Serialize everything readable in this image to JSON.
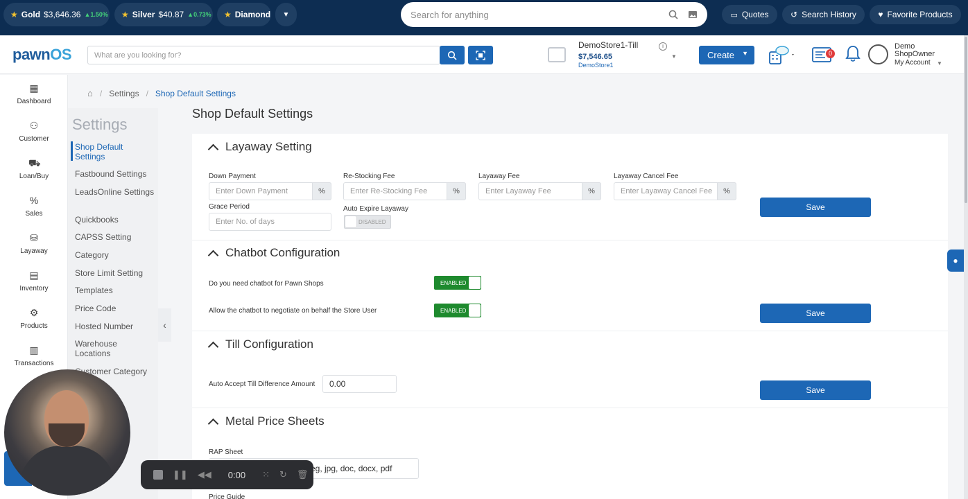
{
  "ticker": {
    "items": [
      {
        "name": "Gold",
        "price": "$3,646.36",
        "change": "▲1.50%"
      },
      {
        "name": "Silver",
        "price": "$40.87",
        "change": "▲0.73%"
      },
      {
        "name": "Diamond",
        "price": "",
        "change": ""
      }
    ],
    "search_placeholder": "Search for anything",
    "quotes_label": "Quotes",
    "history_label": "Search History",
    "favorites_label": "Favorite Products"
  },
  "header": {
    "logo_main": "pawn",
    "logo_accent": "OS",
    "search_placeholder": "What are you looking for?",
    "till_name": "DemoStore1-Till",
    "till_amount": "$7,546.65",
    "till_store": "DemoStore1",
    "create_label": "Create",
    "notification_count": "0",
    "user_name": "Demo ShopOwner",
    "user_account": "My Account"
  },
  "nav": [
    {
      "label": "Dashboard",
      "icon": "dashboard-icon",
      "glyph": "▦"
    },
    {
      "label": "Customer",
      "icon": "customer-icon",
      "glyph": "⚇"
    },
    {
      "label": "Loan/Buy",
      "icon": "loan-icon",
      "glyph": "⛟"
    },
    {
      "label": "Sales",
      "icon": "sales-icon",
      "glyph": "%"
    },
    {
      "label": "Layaway",
      "icon": "layaway-icon",
      "glyph": "⛁"
    },
    {
      "label": "Inventory",
      "icon": "inventory-icon",
      "glyph": "▤"
    },
    {
      "label": "Products",
      "icon": "products-icon",
      "glyph": "⚙"
    },
    {
      "label": "Transactions",
      "icon": "transactions-icon",
      "glyph": "▥"
    }
  ],
  "settings_sidebar": {
    "title": "Settings",
    "items": [
      "Shop Default Settings",
      "Fastbound Settings",
      "LeadsOnline Settings",
      "Quickbooks",
      "CAPSS Setting",
      "Category",
      "Store Limit Setting",
      "Templates",
      "Price Code",
      "Hosted Number",
      "Warehouse Locations",
      "Customer Category"
    ]
  },
  "breadcrumb": {
    "parent": "Settings",
    "current": "Shop Default Settings"
  },
  "page_title": "Shop Default Settings",
  "layaway": {
    "title": "Layaway Setting",
    "down_payment_label": "Down Payment",
    "down_payment_placeholder": "Enter Down Payment",
    "restocking_label": "Re-Stocking Fee",
    "restocking_placeholder": "Enter Re-Stocking Fee",
    "fee_label": "Layaway Fee",
    "fee_placeholder": "Enter Layaway Fee",
    "cancel_label": "Layaway Cancel Fee",
    "cancel_placeholder": "Enter Layaway Cancel Fee",
    "percent": "%",
    "grace_label": "Grace Period",
    "grace_placeholder": "Enter No. of days",
    "auto_expire_label": "Auto Expire Layaway",
    "auto_expire_state": "DISABLED",
    "save_label": "Save"
  },
  "chatbot": {
    "title": "Chatbot Configuration",
    "q1": "Do you need chatbot for Pawn Shops",
    "q1_state": "ENABLED",
    "q2": "Allow the chatbot to negotiate on behalf the Store User",
    "q2_state": "ENABLED",
    "save_label": "Save"
  },
  "till": {
    "title": "Till Configuration",
    "auto_accept_label": "Auto Accept Till Difference Amount",
    "auto_accept_value": "0.00",
    "save_label": "Save"
  },
  "metal": {
    "title": "Metal Price Sheets",
    "rap_label": "RAP Sheet",
    "rap_hint": "eg, jpg, doc, docx, pdf",
    "price_guide_label": "Price Guide"
  },
  "recorder": {
    "time": "0:00"
  }
}
